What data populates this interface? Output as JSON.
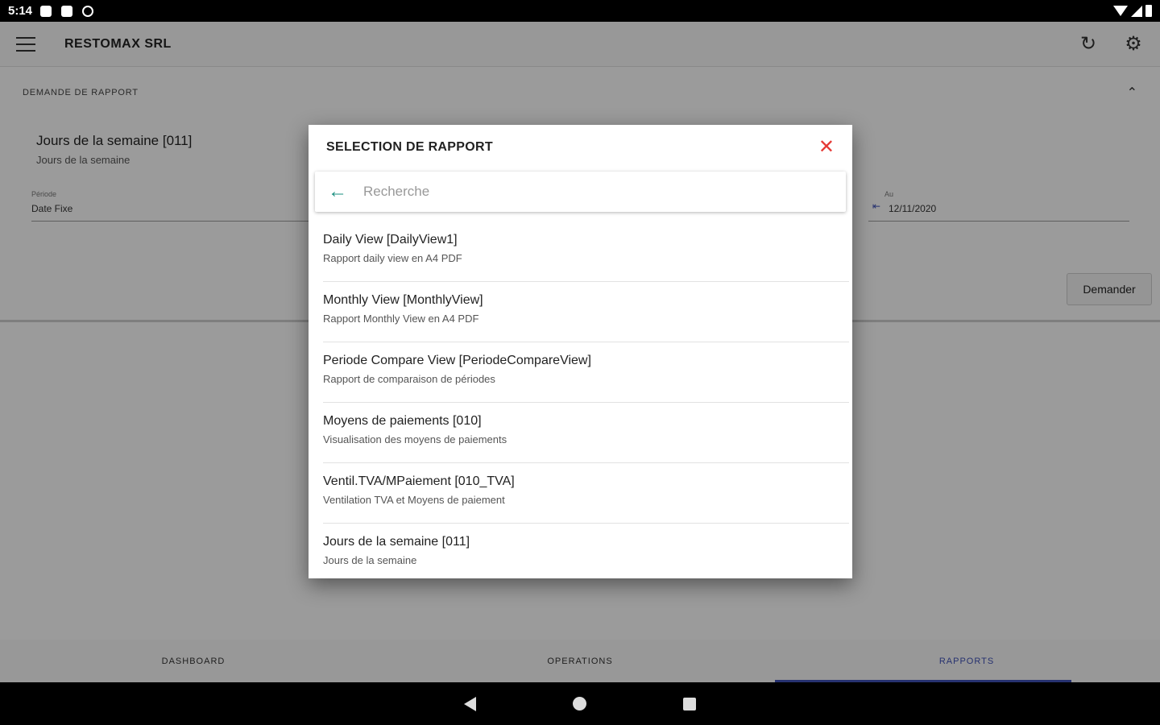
{
  "status_bar": {
    "time": "5:14"
  },
  "app": {
    "title": "RESTOMAX SRL",
    "section_title": "DEMANDE DE RAPPORT",
    "selected_report": {
      "name": "Jours de la semaine [011]",
      "description": "Jours de la semaine"
    },
    "periode": {
      "label": "Période",
      "value": "Date Fixe"
    },
    "au": {
      "label": "Au",
      "value": "12/11/2020"
    },
    "demander_label": "Demander"
  },
  "bottom_nav": {
    "tabs": [
      {
        "label": "DASHBOARD"
      },
      {
        "label": "OPERATIONS"
      },
      {
        "label": "RAPPORTS"
      }
    ]
  },
  "dialog": {
    "title": "SELECTION DE RAPPORT",
    "search_placeholder": "Recherche",
    "reports": [
      {
        "name": "Daily View [DailyView1]",
        "description": "Rapport daily view en A4 PDF"
      },
      {
        "name": "Monthly View [MonthlyView]",
        "description": "Rapport Monthly View en A4 PDF"
      },
      {
        "name": "Periode Compare View [PeriodeCompareView]",
        "description": "Rapport de comparaison de périodes"
      },
      {
        "name": "Moyens de paiements [010]",
        "description": "Visualisation des moyens de paiements"
      },
      {
        "name": "Ventil.TVA/MPaiement [010_TVA]",
        "description": "Ventilation TVA et Moyens de paiement"
      },
      {
        "name": "Jours de la semaine [011]",
        "description": "Jours de la semaine"
      }
    ]
  },
  "colors": {
    "accent": "#3f51b5",
    "close": "#e53935",
    "back_arrow": "#1a8f7f"
  }
}
